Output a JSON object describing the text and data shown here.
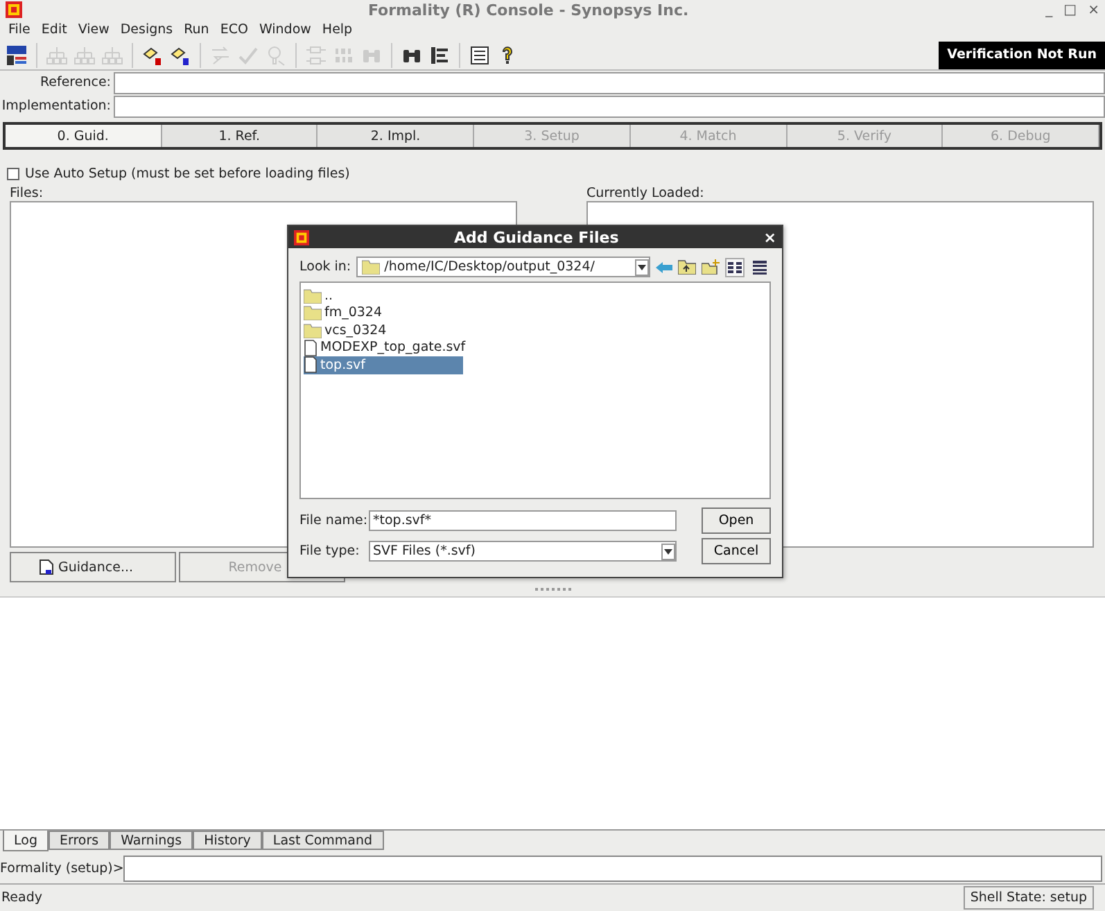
{
  "window": {
    "title": "Formality (R) Console - Synopsys Inc.",
    "controls": [
      "_",
      "□",
      "×"
    ]
  },
  "menu": [
    "File",
    "Edit",
    "View",
    "Designs",
    "Run",
    "ECO",
    "Window",
    "Help"
  ],
  "toolbar": [
    {
      "kind": "app",
      "disabled": false
    },
    {
      "kind": "sep"
    },
    {
      "kind": "tree",
      "disabled": true
    },
    {
      "kind": "tree",
      "disabled": true
    },
    {
      "kind": "tree",
      "disabled": true
    },
    {
      "kind": "sep"
    },
    {
      "kind": "eraser-r",
      "disabled": false
    },
    {
      "kind": "eraser-i",
      "disabled": false
    },
    {
      "kind": "sep"
    },
    {
      "kind": "arrows",
      "disabled": true
    },
    {
      "kind": "check",
      "disabled": true
    },
    {
      "kind": "bulb",
      "disabled": true
    },
    {
      "kind": "sep"
    },
    {
      "kind": "gates",
      "disabled": true
    },
    {
      "kind": "bits",
      "disabled": true
    },
    {
      "kind": "binoculars",
      "disabled": true
    },
    {
      "kind": "sep"
    },
    {
      "kind": "binoculars",
      "disabled": false
    },
    {
      "kind": "align",
      "disabled": false
    },
    {
      "kind": "sep"
    },
    {
      "kind": "list",
      "disabled": false
    },
    {
      "kind": "help",
      "disabled": false
    }
  ],
  "status_badge": "Verification Not Run",
  "design_fields": [
    {
      "label": "Reference:"
    },
    {
      "label": "Implementation:"
    }
  ],
  "steps": [
    {
      "label": "0. Guid.",
      "selected": true,
      "disabled": false
    },
    {
      "label": "1. Ref.",
      "selected": false,
      "disabled": false
    },
    {
      "label": "2. Impl.",
      "selected": false,
      "disabled": false
    },
    {
      "label": "3. Setup",
      "selected": false,
      "disabled": true
    },
    {
      "label": "4. Match",
      "selected": false,
      "disabled": true
    },
    {
      "label": "5. Verify",
      "selected": false,
      "disabled": true
    },
    {
      "label": "6. Debug",
      "selected": false,
      "disabled": true
    }
  ],
  "auto_setup": {
    "label": "Use Auto Setup (must be set before loading files)",
    "checked": false
  },
  "files_label": "Files:",
  "loaded_label": "Currently Loaded:",
  "file_buttons": [
    {
      "label": "Guidance...",
      "disabled": false
    },
    {
      "label": "Remove",
      "disabled": true
    }
  ],
  "log_tabs": [
    {
      "label": "Log",
      "selected": true
    },
    {
      "label": "Errors",
      "selected": false
    },
    {
      "label": "Warnings",
      "selected": false
    },
    {
      "label": "History",
      "selected": false
    },
    {
      "label": "Last Command",
      "selected": false
    }
  ],
  "prompt": "Formality (setup)>",
  "status_bar": {
    "message": "Ready",
    "state": "Shell State: setup"
  },
  "dialog": {
    "title": "Add Guidance Files",
    "close": "×",
    "look_in_label": "Look in:",
    "look_in": "/home/IC/Desktop/output_0324/",
    "view_modes": [
      {
        "kind": "list",
        "selected": true
      },
      {
        "kind": "details",
        "selected": false
      }
    ],
    "files": [
      {
        "name": "..",
        "kind": "folder",
        "selected": false
      },
      {
        "name": "fm_0324",
        "kind": "folder",
        "selected": false
      },
      {
        "name": "vcs_0324",
        "kind": "folder",
        "selected": false
      },
      {
        "name": "MODEXP_top_gate.svf",
        "kind": "file",
        "selected": false
      },
      {
        "name": "top.svf",
        "kind": "file",
        "selected": true
      }
    ],
    "file_name_label": "File name:",
    "file_name": "*top.svf*",
    "file_type_label": "File type:",
    "file_type": "SVF Files (*.svf)",
    "buttons": [
      "Open",
      "Cancel"
    ]
  }
}
